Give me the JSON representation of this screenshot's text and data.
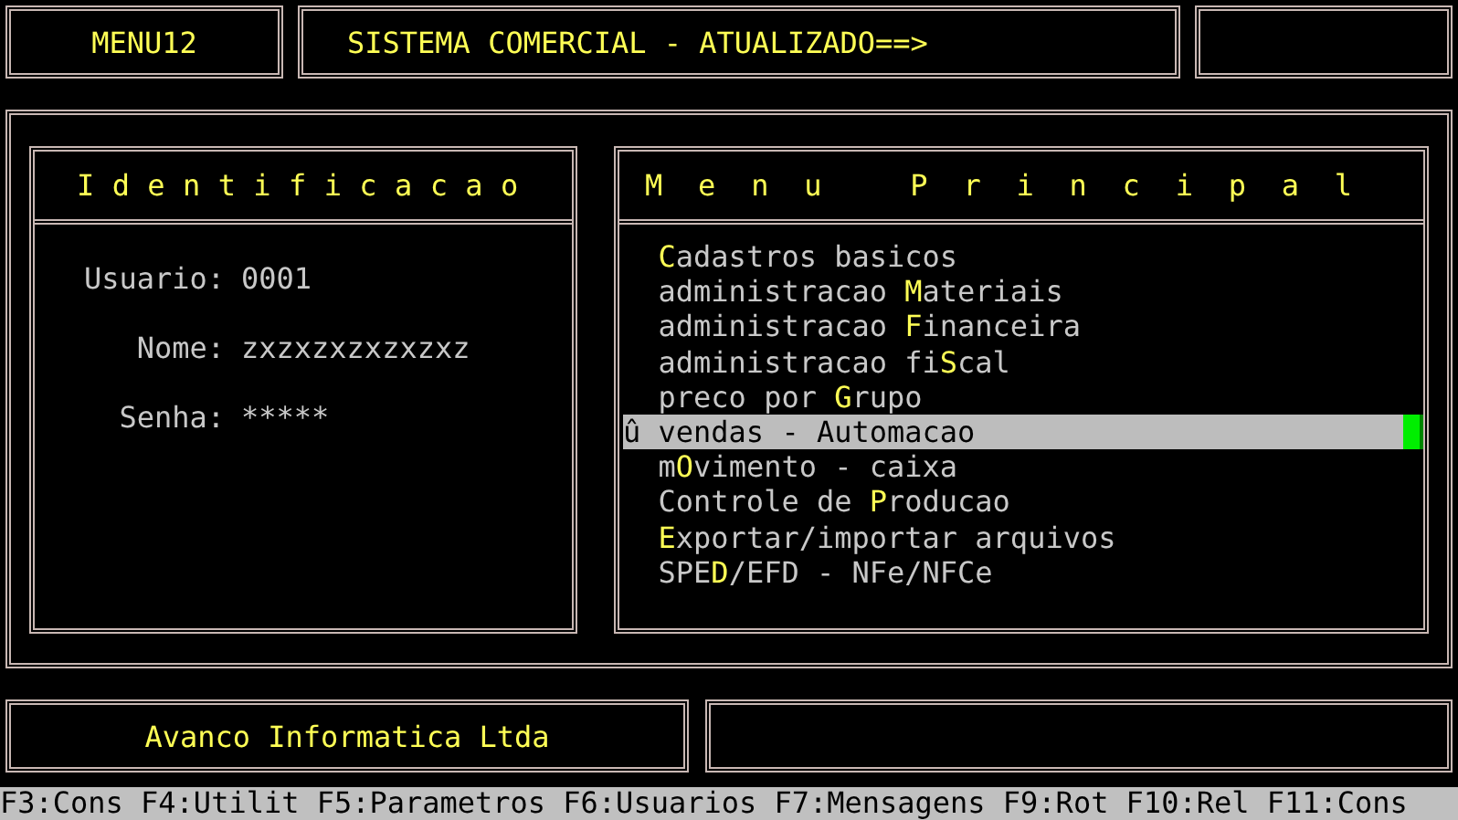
{
  "header": {
    "program_code": "MENU12",
    "title": "SISTEMA COMERCIAL - ATUALIZADO==>"
  },
  "identification": {
    "title": "Identificacao",
    "fields": [
      {
        "label": "Usuario:",
        "value": "0001"
      },
      {
        "label": "Nome:",
        "value": "zxzxzxzxzxzxz"
      },
      {
        "label": "Senha:",
        "value": "*****"
      }
    ]
  },
  "main_menu": {
    "title": "Menu Principal",
    "items": [
      {
        "label": "**C**adastros basicos",
        "selected": false
      },
      {
        "label": "administracao **M**ateriais",
        "selected": false
      },
      {
        "label": "administracao **F**inanceira",
        "selected": false
      },
      {
        "label": "administracao fi**S**cal",
        "selected": false
      },
      {
        "label": "preco por **G**rupo",
        "selected": false
      },
      {
        "label": "û vendas - Automacao",
        "selected": true
      },
      {
        "label": "m**O**vimento - caixa",
        "selected": false
      },
      {
        "label": "Controle de **P**roducao",
        "selected": false
      },
      {
        "label": "**E**xportar/importar arquivos",
        "selected": false
      },
      {
        "label": "SPE**D**/EFD - NFe/NFCe",
        "selected": false
      }
    ]
  },
  "footer": {
    "company": "Avanco Informatica Ltda"
  },
  "function_keys": [
    "F3:Cons",
    "F4:Utilit",
    "F5:Parametros",
    "F6:Usuarios",
    "F7:Mensagens",
    "F9:Rot",
    "F10:Rel",
    "F11:Cons"
  ]
}
